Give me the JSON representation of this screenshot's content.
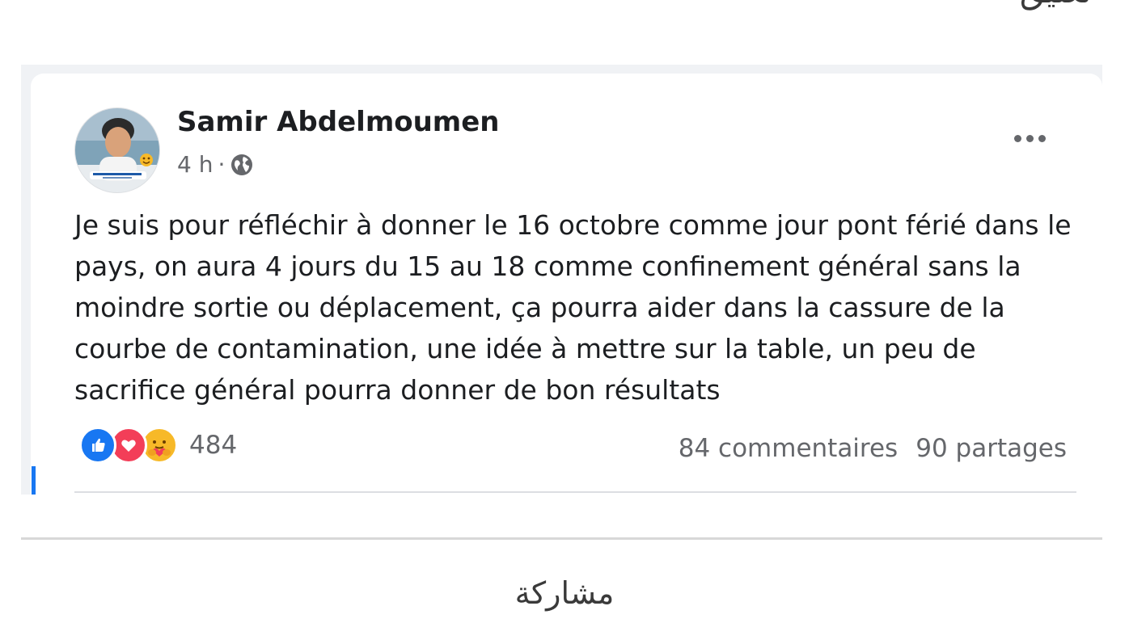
{
  "header": {
    "cut_text": "تعليق"
  },
  "post": {
    "author": "Samir Abdelmoumen",
    "time": "4 h",
    "separator": "·",
    "privacy_icon": "globe-icon",
    "more_icon": "more-options-icon",
    "text": "Je suis pour réfléchir à donner le 16 octobre comme jour pont férié dans le pays, on aura 4 jours du 15 au 18 comme confinement général sans la moindre sortie ou déplacement, ça pourra aider dans la cassure de la courbe de contamination, une idée à mettre sur la table, un peu de sacrifice général pourra donner de bon résultats",
    "reactions": {
      "types": [
        "like",
        "love",
        "care"
      ],
      "count": "484"
    },
    "comments": "84 commentaires",
    "shares": "90 partages"
  },
  "footer": {
    "share_label": "مشاركة"
  },
  "colors": {
    "facebook_blue": "#1877f2",
    "love_red": "#f33e58",
    "care_yellow": "#f7b928",
    "text_primary": "#1c1e21",
    "text_secondary": "#65676b"
  }
}
